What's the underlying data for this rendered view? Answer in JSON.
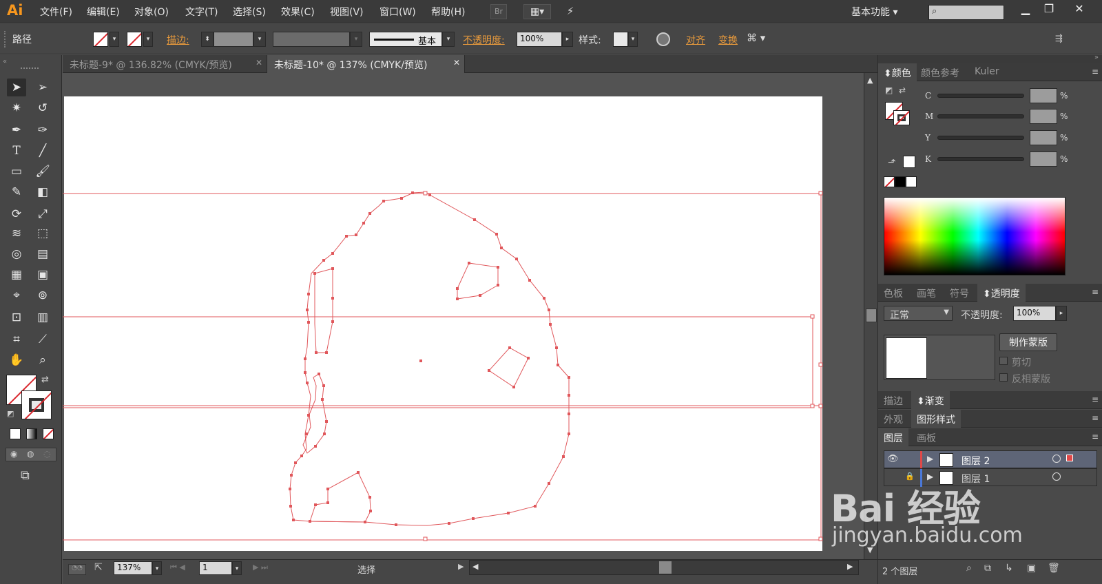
{
  "app": {
    "logo": "Ai",
    "workspace": "基本功能",
    "bridge": "Br"
  },
  "menu": [
    "文件(F)",
    "编辑(E)",
    "对象(O)",
    "文字(T)",
    "选择(S)",
    "效果(C)",
    "视图(V)",
    "窗口(W)",
    "帮助(H)"
  ],
  "control": {
    "selection_type": "路径",
    "stroke_label": "描边:",
    "stroke_style": "基本",
    "opacity_label": "不透明度:",
    "opacity_value": "100%",
    "style_label": "样式:",
    "align_label": "对齐",
    "transform_label": "变换"
  },
  "tabs": [
    {
      "label": "未标题-9* @ 136.82% (CMYK/预览)",
      "active": false
    },
    {
      "label": "未标题-10* @ 137% (CMYK/预览)",
      "active": true
    }
  ],
  "status": {
    "zoom": "137%",
    "artboard": "1",
    "tool": "选择"
  },
  "color_panel": {
    "tabs": [
      "颜色",
      "颜色参考",
      "Kuler"
    ],
    "channels": [
      {
        "label": "C",
        "value": ""
      },
      {
        "label": "M",
        "value": ""
      },
      {
        "label": "Y",
        "value": ""
      },
      {
        "label": "K",
        "value": ""
      }
    ],
    "percent": "%"
  },
  "transparency_panel": {
    "tabs": [
      "色板",
      "画笔",
      "符号",
      "透明度"
    ],
    "blend_mode": "正常",
    "opacity_label": "不透明度:",
    "opacity_value": "100%",
    "make_mask": "制作蒙版",
    "clip": "剪切",
    "invert_mask": "反相蒙版"
  },
  "stroke_panel": {
    "tabs": [
      "描边",
      "渐变"
    ]
  },
  "appearance_panel": {
    "tabs": [
      "外观",
      "图形样式"
    ]
  },
  "layers_panel": {
    "tabs": [
      "图层",
      "画板"
    ],
    "layers": [
      {
        "name": "图层 2"
      },
      {
        "name": "图层 1"
      }
    ],
    "count": "2 个图层"
  },
  "watermark": {
    "brand": "Bai  经验",
    "url": "jingyan.baidu.com"
  },
  "colors": {
    "accent_orange": "#f7971e",
    "path_red": "#e0575b",
    "selection_red": "#d9262c"
  }
}
